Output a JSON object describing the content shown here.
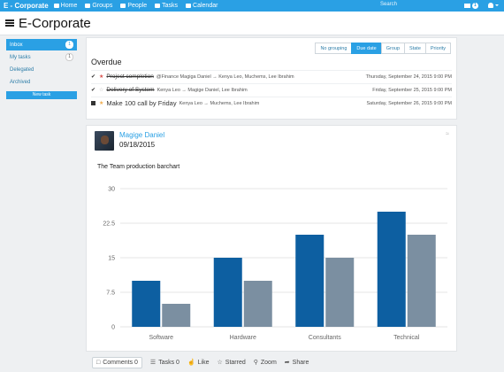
{
  "nav": {
    "brand": "E - Corporate",
    "items": [
      {
        "label": "Home",
        "icon": "home-icon"
      },
      {
        "label": "Groups",
        "icon": "groups-icon"
      },
      {
        "label": "People",
        "icon": "people-icon"
      },
      {
        "label": "Tasks",
        "icon": "tasks-icon"
      },
      {
        "label": "Calendar",
        "icon": "calendar-icon"
      }
    ],
    "search_placeholder": "Search",
    "mail_count": "1"
  },
  "header": {
    "title": "E-Corporate"
  },
  "sidebar": {
    "items": [
      {
        "label": "Inbox",
        "badge": "1"
      },
      {
        "label": "My tasks",
        "badge": "1"
      },
      {
        "label": "Delegated"
      },
      {
        "label": "Archived"
      }
    ],
    "new_task": "New task"
  },
  "overdue": {
    "title": "Overdue",
    "grouping_tabs": [
      "No grouping",
      "Due date",
      "Group",
      "State",
      "Priority"
    ],
    "active_tab": "Due date",
    "tasks": [
      {
        "name": "Project completion",
        "people": "@Finance Magiga Daniel → Kenya Leo, Muchems, Lee Ibrahim",
        "date": "Thursday, September 24, 2015 9:00 PM"
      },
      {
        "name": "Delivery of System",
        "people": "Kenya Leo → Magige Daniel, Lee Ibrahim",
        "date": "Friday, September 25, 2015 9:00 PM"
      },
      {
        "name": "Make 100 call by Friday",
        "people": "Kenya Leo → Muchems, Lee Ibrahim",
        "date": "Saturday, September 26, 2015 9:00 PM"
      }
    ]
  },
  "post": {
    "author": "Magige Daniel",
    "date": "09/18/2015",
    "chart_title": "The Team production barchart"
  },
  "actions": {
    "comments": "Comments 0",
    "tasks": "Tasks 0",
    "like": "Like",
    "starred": "Starred",
    "zoom": "Zoom",
    "share": "Share"
  },
  "chart_data": {
    "type": "bar",
    "categories": [
      "Software",
      "Hardware",
      "Consultants",
      "Technical"
    ],
    "series": [
      {
        "values": [
          10,
          15,
          20,
          25
        ],
        "color": "#0d5fa1"
      },
      {
        "values": [
          5,
          10,
          15,
          20
        ],
        "color": "#7b8fa1"
      }
    ],
    "ylim": [
      0,
      30
    ],
    "yticks": [
      "0",
      "7.5",
      "15",
      "22.5",
      "30"
    ],
    "grid": true
  }
}
